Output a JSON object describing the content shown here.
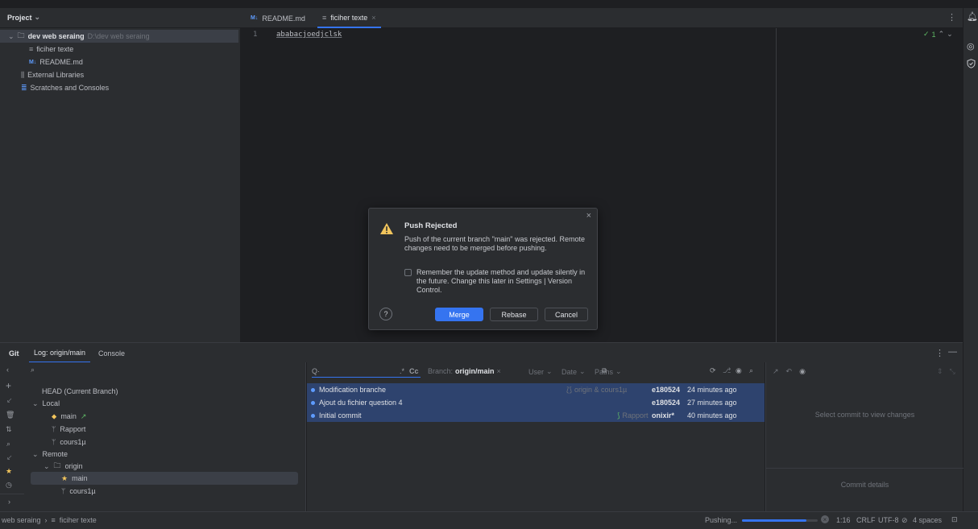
{
  "header": {
    "project_label": "Project",
    "tabs": [
      {
        "badge": "M↓",
        "label": "README.md"
      },
      {
        "label": "ficiher texte"
      }
    ]
  },
  "project_tree": {
    "root_name": "dev web seraing",
    "root_path": "D:\\dev web seraing",
    "items": [
      "ficiher texte",
      "README.md",
      "External Libraries",
      "Scratches and Consoles"
    ],
    "readme_badge": "M↓"
  },
  "editor": {
    "line_number": "1",
    "line_text": "ababacjoedjclsk",
    "inspection_count": "1"
  },
  "dialog": {
    "title": "Push Rejected",
    "message": "Push of the current branch \"main\" was rejected. Remote changes need to be merged before pushing.",
    "checkbox_label": "Remember the update method and update silently in the future. Change this later in Settings | Version Control.",
    "help": "?",
    "merge": "Merge",
    "rebase": "Rebase",
    "cancel": "Cancel",
    "close": "×"
  },
  "git": {
    "title": "Git",
    "tabs": [
      "Log: origin/main",
      "Console"
    ],
    "branches": {
      "head": "HEAD (Current Branch)",
      "local": "Local",
      "local_items": [
        "main",
        "Rapport",
        "cours1µ"
      ],
      "main_arrow": "↗",
      "remote": "Remote",
      "origin": "origin",
      "remote_items": [
        "main",
        "cours1µ"
      ]
    },
    "log": {
      "search_prefix": "Q·",
      "regex": ".*",
      "case": "Cc",
      "branch_label": "Branch:",
      "branch_value": "origin/main",
      "filters": [
        "User",
        "Date",
        "Paths"
      ],
      "rows": [
        {
          "message": "Modification branche",
          "refs": "origin & cours1µ",
          "author": "e180524",
          "time": "24 minutes ago"
        },
        {
          "message": "Ajout du fichier question 4",
          "refs": "",
          "author": "e180524",
          "time": "27 minutes ago"
        },
        {
          "message": "Initial commit",
          "refs": "Rapport",
          "author": "onixir*",
          "time": "40 minutes ago"
        }
      ]
    },
    "details": {
      "empty_changes": "Select commit to view changes",
      "commit_details": "Commit details"
    }
  },
  "statusbar": {
    "breadcrumb": [
      "web seraing",
      "ficiher texte"
    ],
    "progress_label": "Pushing...",
    "progress": 0.85,
    "position": "1:16",
    "line_sep": "CRLF",
    "encoding": "UTF-8",
    "indent": "4 spaces"
  },
  "colors": {
    "accent": "#3574f0",
    "warning": "#f2c55c",
    "graph": "#5e9cff"
  }
}
